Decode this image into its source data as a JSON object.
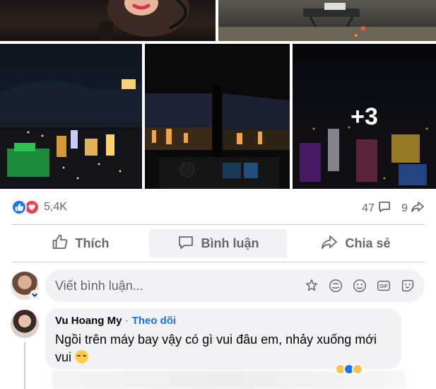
{
  "photos": {
    "more_count": "+3"
  },
  "stats": {
    "reactions_count": "5,4K",
    "comments_count": "47",
    "shares_count": "9"
  },
  "actions": {
    "like": "Thích",
    "comment": "Bình luận",
    "share": "Chia sẻ"
  },
  "composer": {
    "placeholder": "Viết bình luận..."
  },
  "comment": {
    "author": "Vu Hoang My",
    "separator": "·",
    "follow": "Theo dõi",
    "text": "Ngồi trên máy bay vậy có gì vui đâu em, nhảy xuống mới vui"
  },
  "colors": {
    "accent": "#1877f2",
    "love": "#f33e58",
    "muted": "#65676b",
    "follow": "#216fdb",
    "surface": "#f0f2f5"
  }
}
